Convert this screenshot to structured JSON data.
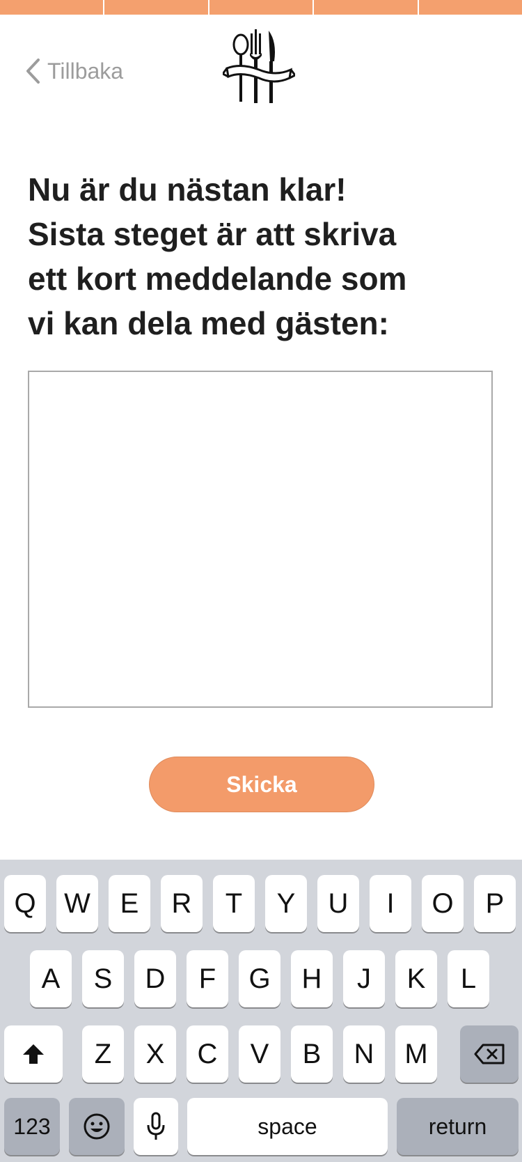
{
  "progress_steps": 5,
  "accent_color": "#f4a06e",
  "nav": {
    "back_label": "Tillbaka",
    "back_icon": "chevron-left-icon",
    "logo_icon": "cutlery-logo-icon"
  },
  "headline": [
    "Nu är du nästan klar!",
    "Sista steget är att skriva",
    "ett kort meddelande som",
    "vi kan dela med gästen:"
  ],
  "message": {
    "value": "",
    "placeholder": ""
  },
  "send_label": "Skicka",
  "keyboard": {
    "row1": [
      "Q",
      "W",
      "E",
      "R",
      "T",
      "Y",
      "U",
      "I",
      "O",
      "P"
    ],
    "row2": [
      "A",
      "S",
      "D",
      "F",
      "G",
      "H",
      "J",
      "K",
      "L"
    ],
    "row3": [
      "Z",
      "X",
      "C",
      "V",
      "B",
      "N",
      "M"
    ],
    "shift_icon": "shift-icon",
    "backspace_icon": "backspace-icon",
    "numbers_label": "123",
    "emoji_icon": "emoji-icon",
    "mic_icon": "microphone-icon",
    "space_label": "space",
    "return_label": "return"
  }
}
